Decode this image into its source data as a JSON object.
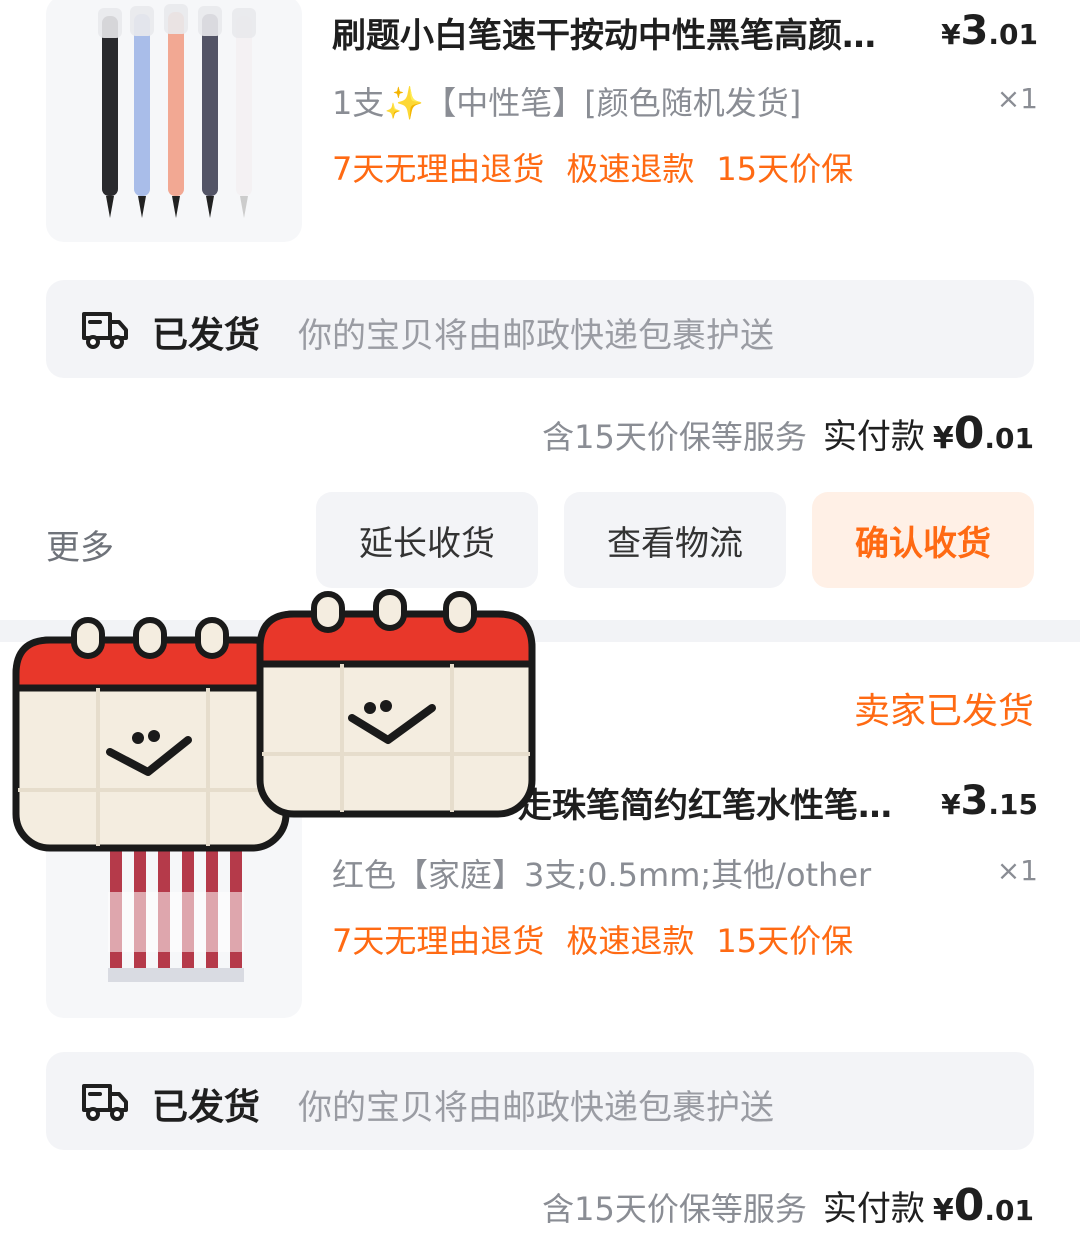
{
  "orders": [
    {
      "product": {
        "title": "刷题小白笔速干按动中性黑笔高颜…",
        "price": {
          "currency": "¥",
          "int": "3",
          "dec": ".01"
        },
        "spec": "1支✨【中性笔】[颜色随机发货]",
        "qty": "×1",
        "tags": [
          "7天无理由退货",
          "极速退款",
          "15天价保"
        ]
      },
      "shipping": {
        "status": "已发货",
        "desc": "你的宝贝将由邮政快递包裹护送"
      },
      "payment": {
        "service": "含15天价保等服务",
        "label": "实付款",
        "currency": "¥",
        "int": "0",
        "dec": ".01"
      },
      "actions": {
        "more": "更多",
        "extend": "延长收货",
        "logistics": "查看物流",
        "confirm": "确认收货"
      }
    },
    {
      "seller_status": "卖家已发货",
      "product": {
        "title": "走珠笔简约红笔水性笔…",
        "price": {
          "currency": "¥",
          "int": "3",
          "dec": ".15"
        },
        "spec": "红色【家庭】3支;0.5mm;其他/other",
        "qty": "×1",
        "tags": [
          "7天无理由退货",
          "极速退款",
          "15天价保"
        ]
      },
      "shipping": {
        "status": "已发货",
        "desc": "你的宝贝将由邮政快递包裹护送"
      },
      "payment": {
        "service": "含15天价保等服务",
        "label": "实付款",
        "currency": "¥",
        "int": "0",
        "dec": ".01"
      }
    }
  ],
  "colors": {
    "accent": "#ff6a13",
    "calendar_red": "#e8372a",
    "calendar_paper": "#f4ede0"
  },
  "icons": [
    "truck-icon",
    "calendar-sticker"
  ]
}
